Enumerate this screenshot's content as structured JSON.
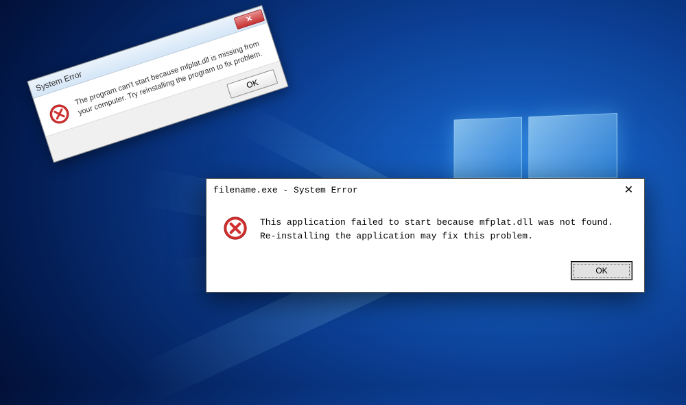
{
  "desktop": {
    "logo": "Windows"
  },
  "dialog1": {
    "title": "System Error",
    "message": "The program can't start because mfplat.dll is missing from your computer. Try reinstalling the program to fix problem.",
    "ok_label": "OK",
    "close_label": "✕"
  },
  "dialog2": {
    "title": "filename.exe - System Error",
    "message": "This application failed to start because mfplat.dll was not found. Re-installing the application may fix this problem.",
    "ok_label": "OK",
    "close_label": "✕"
  },
  "colors": {
    "error_red": "#d03030"
  }
}
